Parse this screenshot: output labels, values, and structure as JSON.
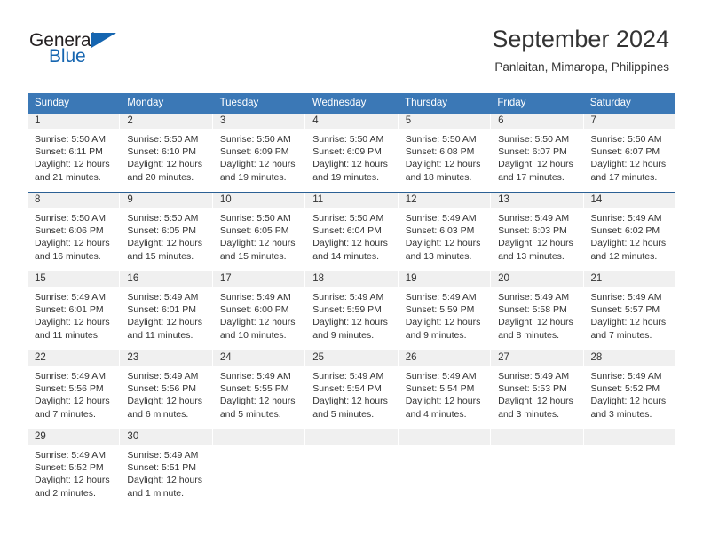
{
  "brand": {
    "name_part1": "General",
    "name_part2": "Blue",
    "flag_icon": "flag-icon"
  },
  "header": {
    "title": "September 2024",
    "subtitle": "Panlaitan, Mimaropa, Philippines"
  },
  "colors": {
    "header_blue": "#3b78b6",
    "row_divider": "#2b6094",
    "brand_blue": "#1565b0",
    "day_band": "#f0f0f0",
    "text": "#333333"
  },
  "calendar": {
    "weekdays": [
      "Sunday",
      "Monday",
      "Tuesday",
      "Wednesday",
      "Thursday",
      "Friday",
      "Saturday"
    ],
    "weeks": [
      [
        {
          "day": "1",
          "sunrise": "Sunrise: 5:50 AM",
          "sunset": "Sunset: 6:11 PM",
          "daylight": "Daylight: 12 hours and 21 minutes."
        },
        {
          "day": "2",
          "sunrise": "Sunrise: 5:50 AM",
          "sunset": "Sunset: 6:10 PM",
          "daylight": "Daylight: 12 hours and 20 minutes."
        },
        {
          "day": "3",
          "sunrise": "Sunrise: 5:50 AM",
          "sunset": "Sunset: 6:09 PM",
          "daylight": "Daylight: 12 hours and 19 minutes."
        },
        {
          "day": "4",
          "sunrise": "Sunrise: 5:50 AM",
          "sunset": "Sunset: 6:09 PM",
          "daylight": "Daylight: 12 hours and 19 minutes."
        },
        {
          "day": "5",
          "sunrise": "Sunrise: 5:50 AM",
          "sunset": "Sunset: 6:08 PM",
          "daylight": "Daylight: 12 hours and 18 minutes."
        },
        {
          "day": "6",
          "sunrise": "Sunrise: 5:50 AM",
          "sunset": "Sunset: 6:07 PM",
          "daylight": "Daylight: 12 hours and 17 minutes."
        },
        {
          "day": "7",
          "sunrise": "Sunrise: 5:50 AM",
          "sunset": "Sunset: 6:07 PM",
          "daylight": "Daylight: 12 hours and 17 minutes."
        }
      ],
      [
        {
          "day": "8",
          "sunrise": "Sunrise: 5:50 AM",
          "sunset": "Sunset: 6:06 PM",
          "daylight": "Daylight: 12 hours and 16 minutes."
        },
        {
          "day": "9",
          "sunrise": "Sunrise: 5:50 AM",
          "sunset": "Sunset: 6:05 PM",
          "daylight": "Daylight: 12 hours and 15 minutes."
        },
        {
          "day": "10",
          "sunrise": "Sunrise: 5:50 AM",
          "sunset": "Sunset: 6:05 PM",
          "daylight": "Daylight: 12 hours and 15 minutes."
        },
        {
          "day": "11",
          "sunrise": "Sunrise: 5:50 AM",
          "sunset": "Sunset: 6:04 PM",
          "daylight": "Daylight: 12 hours and 14 minutes."
        },
        {
          "day": "12",
          "sunrise": "Sunrise: 5:49 AM",
          "sunset": "Sunset: 6:03 PM",
          "daylight": "Daylight: 12 hours and 13 minutes."
        },
        {
          "day": "13",
          "sunrise": "Sunrise: 5:49 AM",
          "sunset": "Sunset: 6:03 PM",
          "daylight": "Daylight: 12 hours and 13 minutes."
        },
        {
          "day": "14",
          "sunrise": "Sunrise: 5:49 AM",
          "sunset": "Sunset: 6:02 PM",
          "daylight": "Daylight: 12 hours and 12 minutes."
        }
      ],
      [
        {
          "day": "15",
          "sunrise": "Sunrise: 5:49 AM",
          "sunset": "Sunset: 6:01 PM",
          "daylight": "Daylight: 12 hours and 11 minutes."
        },
        {
          "day": "16",
          "sunrise": "Sunrise: 5:49 AM",
          "sunset": "Sunset: 6:01 PM",
          "daylight": "Daylight: 12 hours and 11 minutes."
        },
        {
          "day": "17",
          "sunrise": "Sunrise: 5:49 AM",
          "sunset": "Sunset: 6:00 PM",
          "daylight": "Daylight: 12 hours and 10 minutes."
        },
        {
          "day": "18",
          "sunrise": "Sunrise: 5:49 AM",
          "sunset": "Sunset: 5:59 PM",
          "daylight": "Daylight: 12 hours and 9 minutes."
        },
        {
          "day": "19",
          "sunrise": "Sunrise: 5:49 AM",
          "sunset": "Sunset: 5:59 PM",
          "daylight": "Daylight: 12 hours and 9 minutes."
        },
        {
          "day": "20",
          "sunrise": "Sunrise: 5:49 AM",
          "sunset": "Sunset: 5:58 PM",
          "daylight": "Daylight: 12 hours and 8 minutes."
        },
        {
          "day": "21",
          "sunrise": "Sunrise: 5:49 AM",
          "sunset": "Sunset: 5:57 PM",
          "daylight": "Daylight: 12 hours and 7 minutes."
        }
      ],
      [
        {
          "day": "22",
          "sunrise": "Sunrise: 5:49 AM",
          "sunset": "Sunset: 5:56 PM",
          "daylight": "Daylight: 12 hours and 7 minutes."
        },
        {
          "day": "23",
          "sunrise": "Sunrise: 5:49 AM",
          "sunset": "Sunset: 5:56 PM",
          "daylight": "Daylight: 12 hours and 6 minutes."
        },
        {
          "day": "24",
          "sunrise": "Sunrise: 5:49 AM",
          "sunset": "Sunset: 5:55 PM",
          "daylight": "Daylight: 12 hours and 5 minutes."
        },
        {
          "day": "25",
          "sunrise": "Sunrise: 5:49 AM",
          "sunset": "Sunset: 5:54 PM",
          "daylight": "Daylight: 12 hours and 5 minutes."
        },
        {
          "day": "26",
          "sunrise": "Sunrise: 5:49 AM",
          "sunset": "Sunset: 5:54 PM",
          "daylight": "Daylight: 12 hours and 4 minutes."
        },
        {
          "day": "27",
          "sunrise": "Sunrise: 5:49 AM",
          "sunset": "Sunset: 5:53 PM",
          "daylight": "Daylight: 12 hours and 3 minutes."
        },
        {
          "day": "28",
          "sunrise": "Sunrise: 5:49 AM",
          "sunset": "Sunset: 5:52 PM",
          "daylight": "Daylight: 12 hours and 3 minutes."
        }
      ],
      [
        {
          "day": "29",
          "sunrise": "Sunrise: 5:49 AM",
          "sunset": "Sunset: 5:52 PM",
          "daylight": "Daylight: 12 hours and 2 minutes."
        },
        {
          "day": "30",
          "sunrise": "Sunrise: 5:49 AM",
          "sunset": "Sunset: 5:51 PM",
          "daylight": "Daylight: 12 hours and 1 minute."
        },
        {
          "day": "",
          "sunrise": "",
          "sunset": "",
          "daylight": ""
        },
        {
          "day": "",
          "sunrise": "",
          "sunset": "",
          "daylight": ""
        },
        {
          "day": "",
          "sunrise": "",
          "sunset": "",
          "daylight": ""
        },
        {
          "day": "",
          "sunrise": "",
          "sunset": "",
          "daylight": ""
        },
        {
          "day": "",
          "sunrise": "",
          "sunset": "",
          "daylight": ""
        }
      ]
    ]
  }
}
